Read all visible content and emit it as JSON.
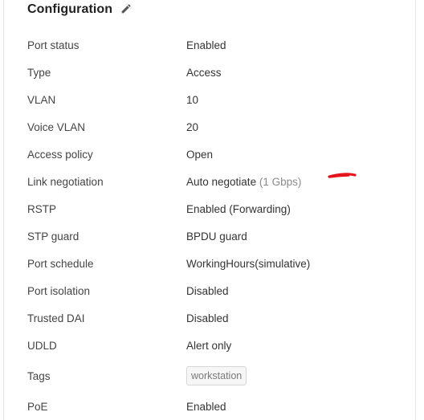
{
  "header": {
    "title": "Configuration",
    "edit_icon": "pencil-icon"
  },
  "rows": [
    {
      "label": "Port status",
      "value": "Enabled"
    },
    {
      "label": "Type",
      "value": "Access"
    },
    {
      "label": "VLAN",
      "value": "10"
    },
    {
      "label": "Voice VLAN",
      "value": "20"
    },
    {
      "label": "Access policy",
      "value": "Open"
    },
    {
      "label": "Link negotiation",
      "value": "Auto negotiate",
      "value_suffix": "(1 Gbps)"
    },
    {
      "label": "RSTP",
      "value": "Enabled (Forwarding)"
    },
    {
      "label": "STP guard",
      "value": "BPDU guard"
    },
    {
      "label": "Port schedule",
      "value": "WorkingHours(simulative)"
    },
    {
      "label": "Port isolation",
      "value": "Disabled"
    },
    {
      "label": "Trusted DAI",
      "value": "Disabled"
    },
    {
      "label": "UDLD",
      "value": "Alert only"
    },
    {
      "label": "Tags",
      "tag": "workstation"
    },
    {
      "label": "PoE",
      "value": "Enabled"
    }
  ],
  "colors": {
    "annotation": "#e8121b",
    "tag_border": "#d7d7d7"
  }
}
